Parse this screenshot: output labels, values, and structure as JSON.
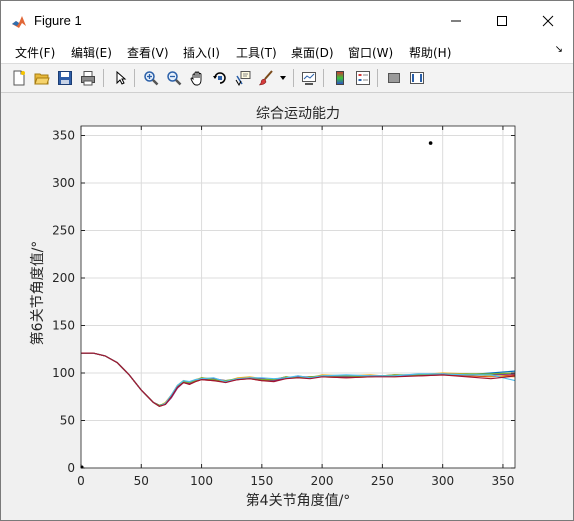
{
  "window": {
    "title": "Figure 1"
  },
  "menu": [
    "文件(F)",
    "编辑(E)",
    "查看(V)",
    "插入(I)",
    "工具(T)",
    "桌面(D)",
    "窗口(W)",
    "帮助(H)"
  ],
  "toolbar_icons": [
    "new-figure-icon",
    "open-file-icon",
    "save-icon",
    "print-icon",
    "pointer-icon",
    "zoom-in-icon",
    "zoom-out-icon",
    "pan-icon",
    "rotate-3d-icon",
    "data-cursor-icon",
    "brush-icon",
    "brush-dropdown-icon",
    "link-plot-icon",
    "colorbar-icon",
    "legend-icon",
    "hide-plot-tools-icon",
    "show-plot-tools-icon"
  ],
  "chart_data": {
    "type": "line",
    "title": "综合运动能力",
    "xlabel": "第4关节角度值/°",
    "ylabel": "第6关节角度值/°",
    "xlim": [
      0,
      360
    ],
    "ylim": [
      0,
      360
    ],
    "xticks": [
      0,
      50,
      100,
      150,
      200,
      250,
      300,
      350
    ],
    "yticks": [
      0,
      50,
      100,
      150,
      200,
      250,
      300,
      350
    ],
    "grid": true,
    "x": [
      0,
      10,
      20,
      30,
      40,
      50,
      60,
      65,
      70,
      75,
      80,
      85,
      90,
      95,
      100,
      110,
      120,
      130,
      140,
      150,
      160,
      170,
      180,
      190,
      200,
      220,
      240,
      260,
      280,
      300,
      320,
      340,
      360
    ],
    "series": [
      {
        "color": "#0072BD",
        "values": [
          121,
          121,
          118,
          111,
          98,
          82,
          69,
          66,
          68,
          76,
          86,
          91,
          89,
          92,
          94,
          93,
          90,
          94,
          95,
          93,
          92,
          95,
          96,
          95,
          97,
          96,
          97,
          97,
          98,
          99,
          98,
          100,
          102
        ]
      },
      {
        "color": "#D95319",
        "values": [
          121,
          121,
          118,
          111,
          98,
          82,
          69,
          65,
          67,
          75,
          85,
          90,
          88,
          91,
          93,
          92,
          91,
          93,
          94,
          92,
          93,
          96,
          95,
          96,
          96,
          95,
          96,
          98,
          97,
          98,
          97,
          96,
          98
        ]
      },
      {
        "color": "#EDB120",
        "values": [
          121,
          121,
          118,
          111,
          98,
          82,
          69,
          65,
          69,
          77,
          87,
          92,
          90,
          93,
          95,
          94,
          91,
          95,
          96,
          94,
          93,
          94,
          97,
          95,
          98,
          97,
          98,
          96,
          98,
          100,
          99,
          97,
          96
        ]
      },
      {
        "color": "#7E2F8E",
        "values": [
          121,
          121,
          118,
          111,
          98,
          82,
          69,
          66,
          67,
          74,
          84,
          90,
          89,
          92,
          94,
          94,
          92,
          93,
          95,
          94,
          92,
          95,
          96,
          96,
          96,
          96,
          97,
          97,
          97,
          99,
          98,
          98,
          99
        ]
      },
      {
        "color": "#77AC30",
        "values": [
          121,
          121,
          118,
          111,
          98,
          82,
          69,
          66,
          68,
          76,
          86,
          91,
          90,
          92,
          95,
          93,
          92,
          94,
          94,
          93,
          93,
          96,
          95,
          96,
          97,
          97,
          96,
          98,
          98,
          98,
          99,
          99,
          100
        ]
      },
      {
        "color": "#4DBEEE",
        "values": [
          121,
          121,
          118,
          111,
          98,
          82,
          69,
          65,
          68,
          77,
          87,
          92,
          91,
          93,
          94,
          95,
          91,
          94,
          95,
          95,
          94,
          95,
          97,
          95,
          97,
          98,
          97,
          97,
          99,
          99,
          98,
          98,
          92
        ]
      },
      {
        "color": "#A2142F",
        "values": [
          121,
          121,
          118,
          111,
          98,
          82,
          69,
          65,
          67,
          75,
          85,
          90,
          88,
          91,
          93,
          92,
          90,
          93,
          94,
          92,
          91,
          94,
          95,
          94,
          96,
          95,
          96,
          96,
          97,
          98,
          96,
          94,
          97
        ]
      }
    ],
    "points": [
      {
        "x": 290,
        "y": 342,
        "color": "#000000"
      }
    ]
  }
}
